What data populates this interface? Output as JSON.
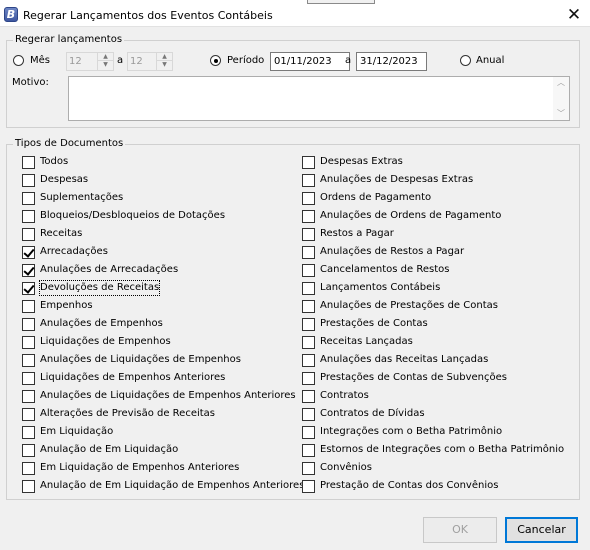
{
  "window": {
    "title": "Regerar Lançamentos dos Eventos Contábeis",
    "icon_letter": "B",
    "close_glyph": "✕"
  },
  "regerar": {
    "legend": "Regerar lançamentos",
    "mes_label": "Mês",
    "mes_start": "12",
    "mes_a": "a",
    "mes_end": "12",
    "periodo_label": "Período",
    "periodo_start": "01/11/2023",
    "periodo_a": "a",
    "periodo_end": "31/12/2023",
    "anual_label": "Anual",
    "selected": "periodo",
    "motivo_label": "Motivo:",
    "motivo_value": ""
  },
  "tipos": {
    "legend": "Tipos de Documentos",
    "left": [
      {
        "label": "Todos",
        "checked": false
      },
      {
        "label": "Despesas",
        "checked": false
      },
      {
        "label": "Suplementações",
        "checked": false
      },
      {
        "label": "Bloqueios/Desbloqueios de Dotações",
        "checked": false
      },
      {
        "label": "Receitas",
        "checked": false
      },
      {
        "label": "Arrecadações",
        "checked": true
      },
      {
        "label": "Anulações de Arrecadações",
        "checked": true
      },
      {
        "label": "Devoluções de Receitas",
        "checked": true
      },
      {
        "label": "Empenhos",
        "checked": false
      },
      {
        "label": "Anulações de Empenhos",
        "checked": false
      },
      {
        "label": "Liquidações de Empenhos",
        "checked": false
      },
      {
        "label": "Anulações de Liquidações de Empenhos",
        "checked": false
      },
      {
        "label": "Liquidações de Empenhos Anteriores",
        "checked": false
      },
      {
        "label": "Anulações de Liquidações de Empenhos Anteriores",
        "checked": false
      },
      {
        "label": "Alterações de Previsão de Receitas",
        "checked": false
      },
      {
        "label": "Em Liquidação",
        "checked": false
      },
      {
        "label": "Anulação de Em Liquidação",
        "checked": false
      },
      {
        "label": "Em Liquidação de Empenhos Anteriores",
        "checked": false
      },
      {
        "label": "Anulação de Em Liquidação de Empenhos Anteriores",
        "checked": false
      }
    ],
    "right": [
      {
        "label": "Despesas Extras",
        "checked": false
      },
      {
        "label": "Anulações de Despesas Extras",
        "checked": false
      },
      {
        "label": "Ordens de Pagamento",
        "checked": false
      },
      {
        "label": "Anulações de Ordens de Pagamento",
        "checked": false
      },
      {
        "label": "Restos a Pagar",
        "checked": false
      },
      {
        "label": "Anulações de Restos a Pagar",
        "checked": false
      },
      {
        "label": "Cancelamentos de Restos",
        "checked": false
      },
      {
        "label": "Lançamentos Contábeis",
        "checked": false
      },
      {
        "label": "Anulações de Prestações de Contas",
        "checked": false
      },
      {
        "label": "Prestações de Contas",
        "checked": false
      },
      {
        "label": "Receitas Lançadas",
        "checked": false
      },
      {
        "label": "Anulações das Receitas Lançadas",
        "checked": false
      },
      {
        "label": "Prestações de Contas de Subvenções",
        "checked": false
      },
      {
        "label": "Contratos",
        "checked": false
      },
      {
        "label": "Contratos de Dívidas",
        "checked": false
      },
      {
        "label": "Integrações com o Betha Patrimônio",
        "checked": false
      },
      {
        "label": "Estornos de Integrações com o Betha Patrimônio",
        "checked": false
      },
      {
        "label": "Convênios",
        "checked": false
      },
      {
        "label": "Prestação de Contas dos Convênios",
        "checked": false
      }
    ],
    "focused": "Devoluções de Receitas"
  },
  "buttons": {
    "ok_label": "OK",
    "ok_enabled": false,
    "cancel_label": "Cancelar"
  }
}
